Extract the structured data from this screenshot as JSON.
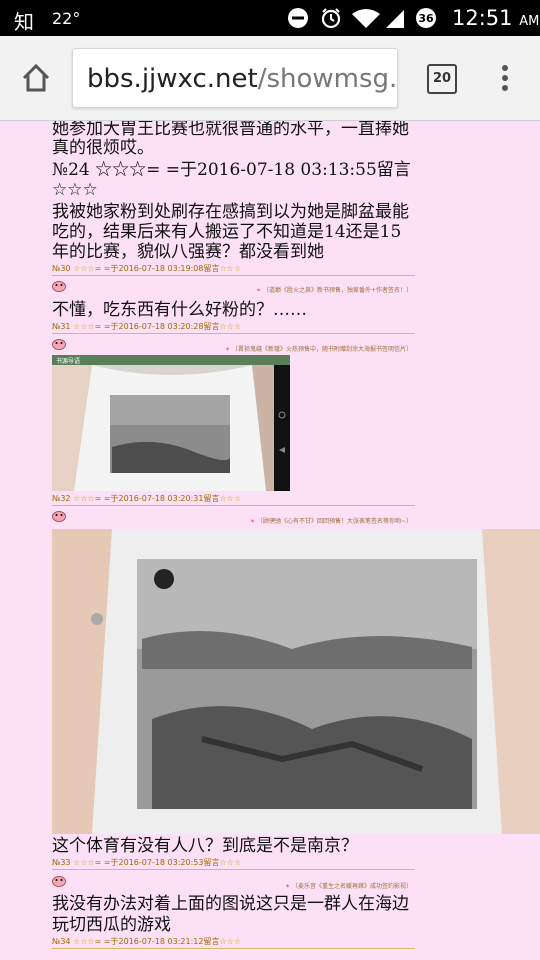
{
  "status_bar": {
    "app_glyph": "知",
    "temperature": "22°",
    "notification_count": "36",
    "time": "12:51",
    "ampm": "AM"
  },
  "browser": {
    "url_domain": "bbs.jjwxc.net",
    "url_path": "/showmsg.ph",
    "tab_count": "20"
  },
  "posts": [
    {
      "lines": [
        "她参加大胃王比赛也就很普通的水平，一直捧她",
        "真的很烦哎。",
        "№24 ☆☆☆= =于2016-07-18 03:13:55留言",
        "☆☆☆",
        "我被她家粉到处刷存在感搞到以为她是脚盆最能",
        "吃的，结果后来有人搬运了不知道是14还是15",
        "年的比赛，貌似八强赛？都没看到她"
      ],
      "meta_no": "№30",
      "meta_text": "= =于2016-07-18 03:19:08留言"
    },
    {
      "banner": "〔道巅《胜火之泉》新书预售，独家番外+作者签名！〕",
      "lines": [
        "不懂，吃东西有什么好粉的？……"
      ],
      "meta_no": "№31",
      "meta_text": "= =于2016-07-18 03:20:28留言"
    },
    {
      "banner": "〔晋祯鬼缝《新蔻》火热预售中，随书附赠刮涂大海报书签明信片〕",
      "lines": [],
      "meta_no": "№32",
      "meta_text": "= =于2016-07-18 03:20:31留言"
    },
    {
      "banner": "〔顾骋驰《心有不甘》回回预售！大张表笔签名等你哟~〕",
      "lines": [
        "这个体育有没有人八？到底是不是南京？"
      ],
      "meta_no": "№33",
      "meta_text": "= =于2016-07-18 03:20:53留言"
    },
    {
      "banner": "〔麦乐音《重生之名媛再嫁》成功签约影视〕",
      "lines": [
        "我没有办法对着上面的图说这只是一群人在海边",
        "玩切西瓜的游戏"
      ],
      "meta_no": "№34",
      "meta_text": "= =于2016-07-18 03:21:12留言"
    }
  ],
  "stars": "☆☆☆",
  "embedded_screenshot_header": "书源导语",
  "colors": {
    "page_background": "#fce0f5",
    "meta_text": "#a06a00",
    "stars": "#caa400",
    "divider": "#d8b96a"
  },
  "icons": [
    "zhihu-icon",
    "notification-mute-icon",
    "alarm-icon",
    "wifi-icon",
    "signal-icon",
    "home-icon",
    "tab-switcher-icon",
    "overflow-menu-icon",
    "post-avatar-icon"
  ]
}
